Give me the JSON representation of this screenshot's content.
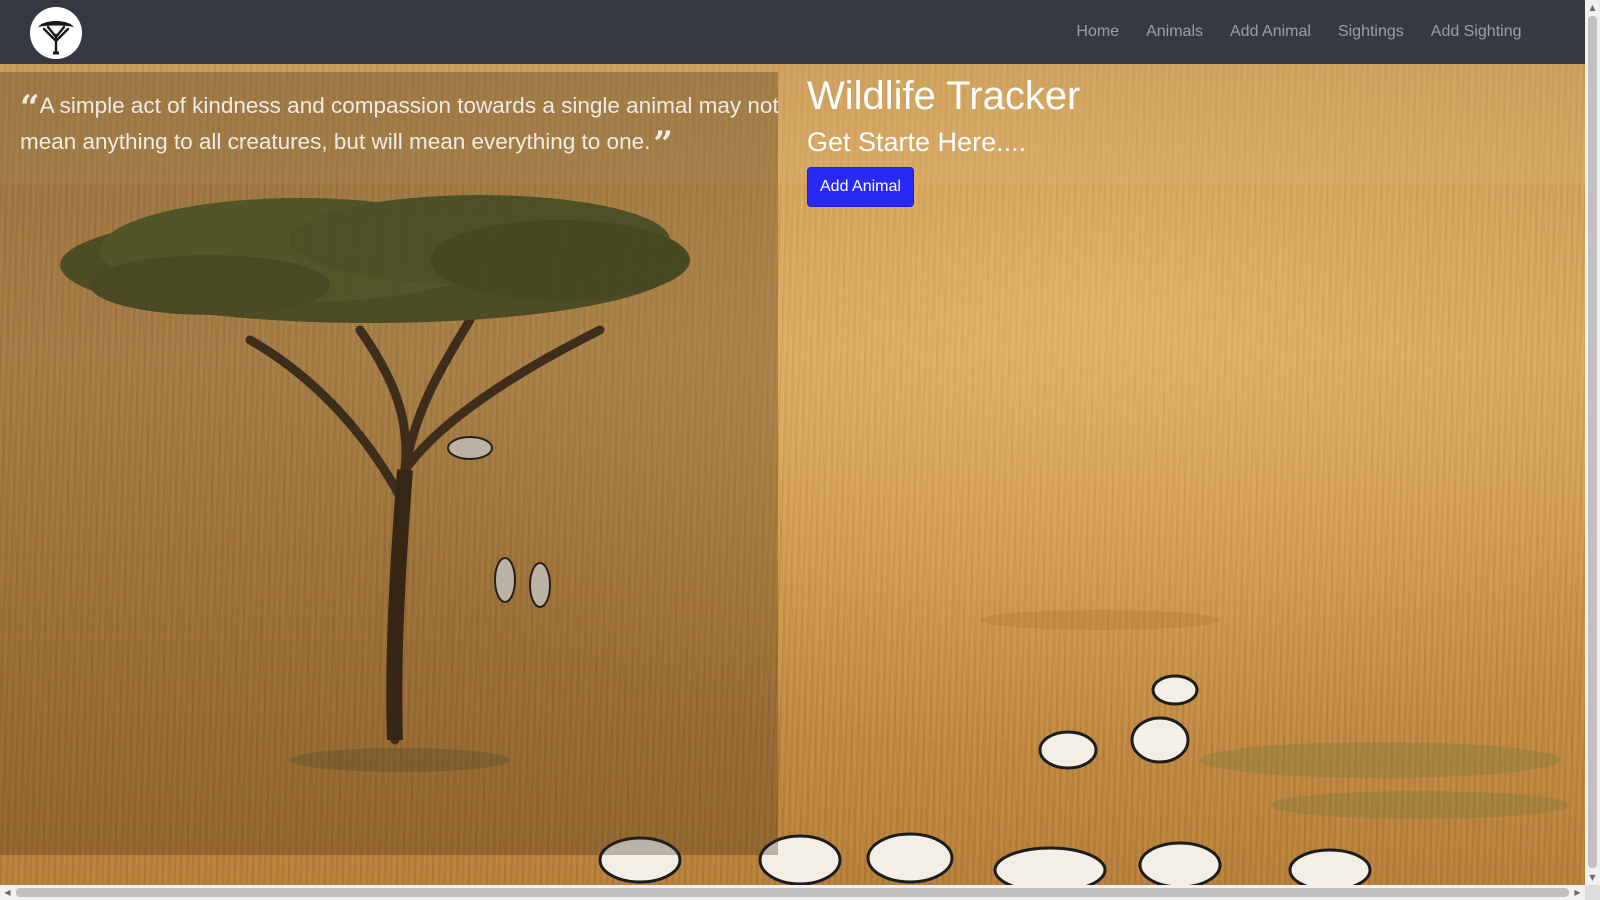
{
  "navbar": {
    "logo_icon": "acacia-tree-logo-icon",
    "links": [
      {
        "label": "Home"
      },
      {
        "label": "Animals"
      },
      {
        "label": "Add Animal"
      },
      {
        "label": "Sightings"
      },
      {
        "label": "Add Sighting"
      }
    ]
  },
  "quote": {
    "text": "A simple act of kindness and compassion towards a single animal may not mean anything to all creatures, but will mean everything to one.",
    "open_icon": "quote-open-icon",
    "close_icon": "quote-close-icon"
  },
  "hero": {
    "title": "Wildlife Tracker",
    "subtitle": "Get Starte Here....",
    "button_label": "Add Animal"
  },
  "colors": {
    "navbar_bg": "#343a40",
    "nav_link": "rgba(255,255,255,0.5)",
    "primary_button": "#2929f5",
    "savanna": "#c9934a"
  }
}
